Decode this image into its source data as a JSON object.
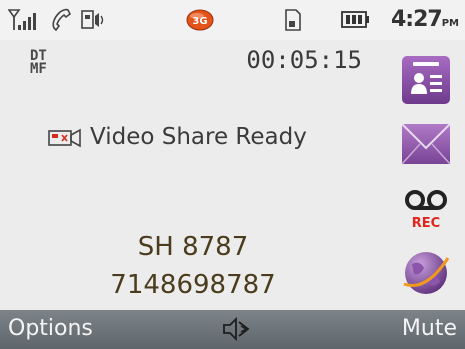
{
  "status": {
    "icons": [
      "signal-icon",
      "phone-icon",
      "speaker-icon",
      "3g-icon",
      "sim-card-icon",
      "battery-icon"
    ],
    "time": "4:27",
    "ampm": "PM",
    "accent_3g": "#e2541a"
  },
  "call": {
    "dtmf_label_line1": "DT",
    "dtmf_label_line2": "MF",
    "elapsed": "00:05:15",
    "video_share_status": "Video Share Ready",
    "caller_name": "SH 8787",
    "caller_number": "7148698787"
  },
  "shortcuts": [
    "contacts-icon",
    "messages-icon",
    "voice-record-icon",
    "browser-icon"
  ],
  "rec_label": "REC",
  "softkeys": {
    "left": "Options",
    "center_icon": "speakerphone-icon",
    "right": "Mute"
  },
  "colors": {
    "softbar": "#6d757a",
    "shortcut_purple": "#8a4fa6",
    "rec_red": "#e0261c"
  }
}
